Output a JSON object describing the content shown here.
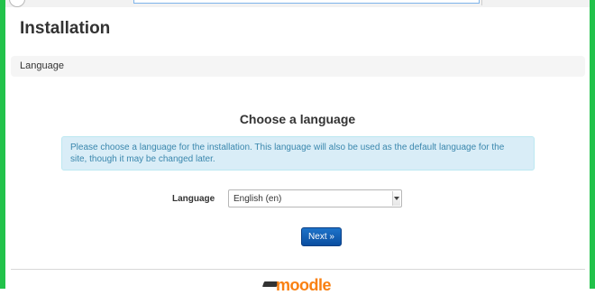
{
  "header": {
    "title": "Installation"
  },
  "breadcrumb": {
    "current": "Language"
  },
  "main": {
    "heading": "Choose a language",
    "info_message": "Please choose a language for the installation. This language will also be used as the default language for the site, though it may be changed later.",
    "language_field": {
      "label": "Language",
      "selected": "English (en)"
    },
    "next_button_label": "Next »"
  },
  "footer": {
    "logo_text": "moodle"
  },
  "colors": {
    "frame_accent": "#22c24a",
    "info_background": "#d9edf7",
    "info_text": "#3a87ad",
    "primary_button": "#0f5fb5",
    "logo_orange": "#f98012"
  },
  "icons": [
    "browser-home-icon",
    "dropdown-arrow-icon",
    "moodle-logo-icon"
  ]
}
